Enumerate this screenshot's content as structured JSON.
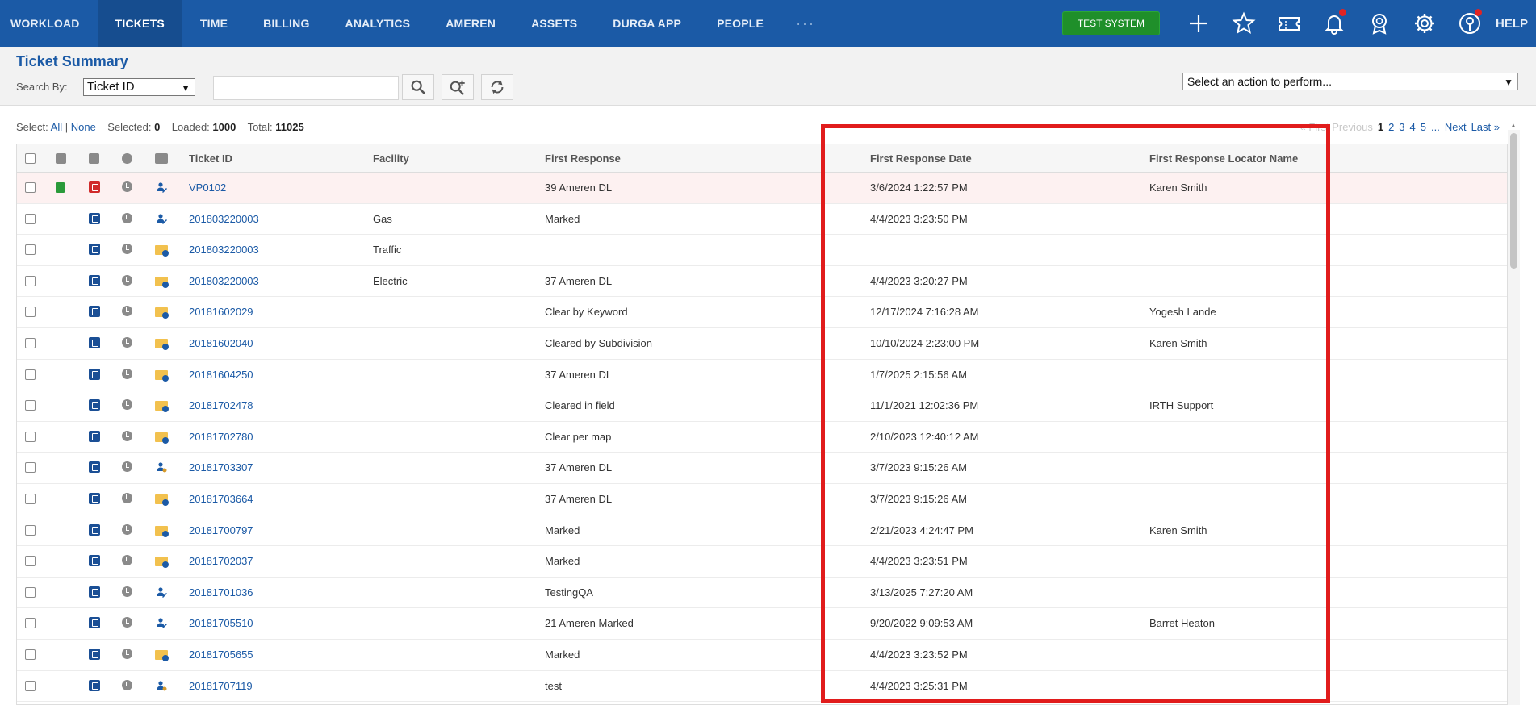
{
  "nav": {
    "items": [
      {
        "label": "WORKLOAD"
      },
      {
        "label": "TICKETS"
      },
      {
        "label": "TIME"
      },
      {
        "label": "BILLING"
      },
      {
        "label": "ANALYTICS"
      },
      {
        "label": "AMEREN"
      },
      {
        "label": "ASSETS"
      },
      {
        "label": "DURGA APP"
      },
      {
        "label": "PEOPLE"
      }
    ],
    "more": "···",
    "active": "TICKETS",
    "test_system": "TEST SYSTEM",
    "help": "HELP",
    "icons": [
      "plus-icon",
      "star-icon",
      "ticket-icon",
      "bell-icon",
      "award-icon",
      "gear-icon",
      "user-icon"
    ]
  },
  "search": {
    "title": "Ticket Summary",
    "label": "Search By:",
    "selected": "Ticket ID",
    "input_value": "",
    "action_placeholder": "Select an action to perform..."
  },
  "status": {
    "select_label": "Select:",
    "all": "All",
    "sep": "|",
    "none": "None",
    "selected_label": "Selected:",
    "selected_value": "0",
    "loaded_label": "Loaded:",
    "loaded_value": "1000",
    "total_label": "Total:",
    "total_value": "11025"
  },
  "pager": {
    "first": "« First",
    "previous": "Previous",
    "current": "1",
    "pages": [
      "2",
      "3",
      "4",
      "5"
    ],
    "ellipsis": "...",
    "next": "Next",
    "last": "Last »"
  },
  "table": {
    "columns": [
      "Ticket ID",
      "Facility",
      "First Response",
      "First Response Date",
      "First Response Locator Name"
    ],
    "rows": [
      {
        "id": "VP0102",
        "facility": "",
        "response": "39 Ameren DL",
        "date": "3/6/2024 1:22:57 PM",
        "locator": "Karen Smith",
        "type": "E",
        "status": "person-pen",
        "highlight": true
      },
      {
        "id": "201803220003",
        "facility": "Gas",
        "response": "Marked",
        "date": "4/4/2023 3:23:50 PM",
        "locator": "",
        "type": "R",
        "status": "person-pen"
      },
      {
        "id": "201803220003",
        "facility": "Traffic",
        "response": "",
        "date": "",
        "locator": "",
        "type": "R",
        "status": "folder"
      },
      {
        "id": "201803220003",
        "facility": "Electric",
        "response": "37 Ameren DL",
        "date": "4/4/2023 3:20:27 PM",
        "locator": "",
        "type": "R",
        "status": "folder"
      },
      {
        "id": "20181602029",
        "facility": "",
        "response": "Clear by Keyword",
        "date": "12/17/2024 7:16:28 AM",
        "locator": "Yogesh Lande",
        "type": "R",
        "status": "folder"
      },
      {
        "id": "20181602040",
        "facility": "",
        "response": "Cleared by Subdivision",
        "date": "10/10/2024 2:23:00 PM",
        "locator": "Karen Smith",
        "type": "R",
        "status": "folder"
      },
      {
        "id": "20181604250",
        "facility": "",
        "response": "37 Ameren DL",
        "date": "1/7/2025 2:15:56 AM",
        "locator": "",
        "type": "R",
        "status": "folder"
      },
      {
        "id": "20181702478",
        "facility": "",
        "response": "Cleared in field",
        "date": "11/1/2021 12:02:36 PM",
        "locator": "IRTH Support",
        "type": "R",
        "status": "folder"
      },
      {
        "id": "20181702780",
        "facility": "",
        "response": "Clear per map",
        "date": "2/10/2023 12:40:12 AM",
        "locator": "",
        "type": "R",
        "status": "folder"
      },
      {
        "id": "20181703307",
        "facility": "",
        "response": "37 Ameren DL",
        "date": "3/7/2023 9:15:26 AM",
        "locator": "",
        "type": "R",
        "status": "person"
      },
      {
        "id": "20181703664",
        "facility": "",
        "response": "37 Ameren DL",
        "date": "3/7/2023 9:15:26 AM",
        "locator": "",
        "type": "R",
        "status": "folder"
      },
      {
        "id": "20181700797",
        "facility": "",
        "response": "Marked",
        "date": "2/21/2023 4:24:47 PM",
        "locator": "Karen Smith",
        "type": "R",
        "status": "folder"
      },
      {
        "id": "20181702037",
        "facility": "",
        "response": "Marked",
        "date": "4/4/2023 3:23:51 PM",
        "locator": "",
        "type": "R",
        "status": "folder"
      },
      {
        "id": "20181701036",
        "facility": "",
        "response": "TestingQA",
        "date": "3/13/2025 7:27:20 AM",
        "locator": "",
        "type": "R",
        "status": "person-pen"
      },
      {
        "id": "20181705510",
        "facility": "",
        "response": "21 Ameren Marked",
        "date": "9/20/2022 9:09:53 AM",
        "locator": "Barret Heaton",
        "type": "R",
        "status": "person-pen"
      },
      {
        "id": "20181705655",
        "facility": "",
        "response": "Marked",
        "date": "4/4/2023 3:23:52 PM",
        "locator": "",
        "type": "R",
        "status": "folder"
      },
      {
        "id": "20181707119",
        "facility": "",
        "response": "test",
        "date": "4/4/2023 3:25:31 PM",
        "locator": "",
        "type": "R",
        "status": "person"
      }
    ]
  },
  "colors": {
    "nav_bg": "#1b5aa6",
    "link": "#1b5aa6",
    "test_button": "#1f8f2a",
    "annotation": "#e11c1c",
    "highlight_row": "#fdf1f1"
  }
}
